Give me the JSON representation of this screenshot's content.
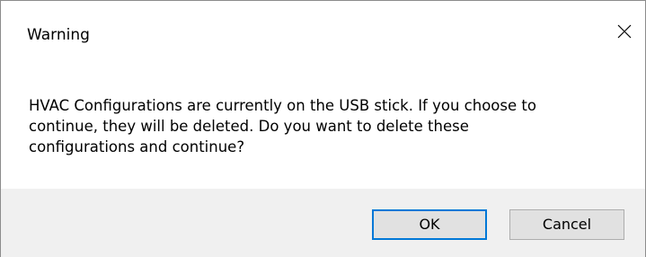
{
  "window": {
    "title": "Warning"
  },
  "icons": {
    "close": "close-icon"
  },
  "message": {
    "line1": "HVAC Configurations are currently on the USB stick. If you choose to",
    "line2": "continue, they will be deleted. Do you want to delete these",
    "line3": "configurations and continue?"
  },
  "buttons": {
    "ok_label": "OK",
    "cancel_label": "Cancel"
  },
  "colors": {
    "footer_background": "#f0f0f0",
    "button_background": "#e1e1e1",
    "focus_border": "#0078d7"
  }
}
